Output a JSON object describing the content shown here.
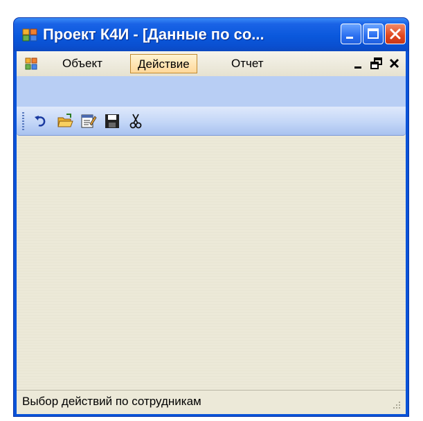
{
  "window": {
    "title": "Проект К4И - [Данные по со..."
  },
  "menu": {
    "items": [
      {
        "label": "Объект"
      },
      {
        "label": "Действие"
      },
      {
        "label": "Отчет"
      }
    ]
  },
  "toolbar": {
    "buttons": [
      "undo-icon",
      "open-folder-icon",
      "edit-icon",
      "save-icon",
      "cut-icon"
    ]
  },
  "status": {
    "text": "Выбор действий по сотрудникам"
  },
  "colors": {
    "titlebar": "#0a58dc",
    "client": "#ece9d8",
    "blue_band": "#b8cef4",
    "active_menu": "#ffd89a"
  }
}
